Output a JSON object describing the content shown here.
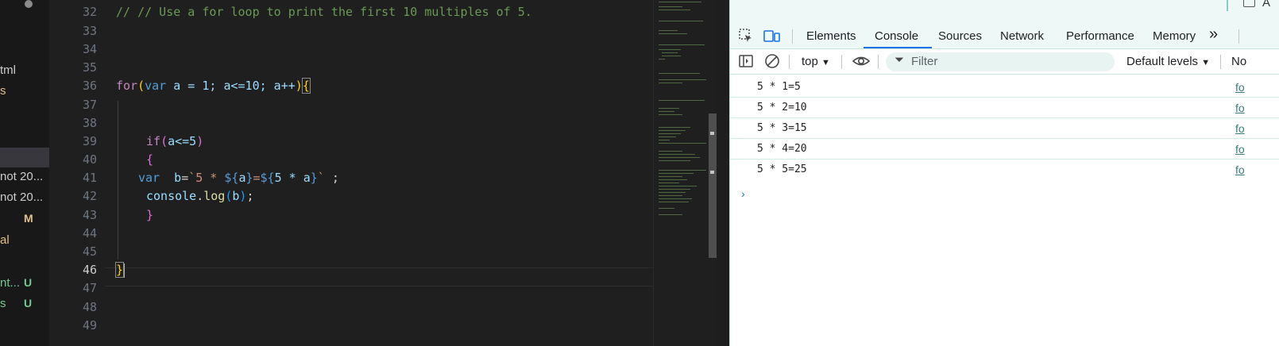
{
  "explorer": {
    "items": [
      {
        "label": "tml"
      },
      {
        "label": "s"
      },
      {
        "label": "not 20..."
      },
      {
        "label": "not 20..."
      },
      {
        "label": "al"
      },
      {
        "label": "nt..."
      },
      {
        "label": "s"
      }
    ],
    "badges": [
      "M",
      "U",
      "U"
    ]
  },
  "editor": {
    "line_numbers": [
      "32",
      "33",
      "34",
      "35",
      "36",
      "37",
      "38",
      "39",
      "40",
      "41",
      "42",
      "43",
      "44",
      "45",
      "46",
      "47",
      "48",
      "49"
    ],
    "active_line": "46",
    "lines": {
      "l32": "// // Use a for loop to print the first 10 multiples of 5.",
      "l36": {
        "kw": "for",
        "p1o": "(",
        "kb": "var",
        "rest": " a = 1; a<=10; a++",
        "p1c": ")",
        "brace": "{"
      },
      "l39": {
        "kw": "if",
        "p2o": "(",
        "rest": "a<=5",
        "p2c": ")"
      },
      "l40": "{",
      "l41": {
        "kb": "var",
        "v": "  b",
        "eq": "=",
        "tpl1": "`5 * ",
        "d1": "${",
        "a1": "a",
        "c1": "}",
        "eq2": "=",
        "d2": "${",
        "e2": "5 * a",
        "c2": "}",
        "tpl2": "`",
        "end": " ;"
      },
      "l42": {
        "obj": "console",
        "dot": ".",
        "fn": "log",
        "po": "(",
        "arg": "b",
        "pc": ")",
        "semi": ";"
      },
      "l43": "}",
      "l46": "}"
    }
  },
  "devtools": {
    "tabs": [
      "Elements",
      "Console",
      "Sources",
      "Network",
      "Performance",
      "Memory"
    ],
    "active_tab": "Console",
    "more_tabs": "»",
    "top_right_text": "A",
    "console_bar": {
      "context": "top",
      "filter_placeholder": "Filter",
      "levels": "Default levels",
      "issues": "No"
    },
    "messages": [
      {
        "text": "5 * 1=5",
        "source": "fo"
      },
      {
        "text": "5 * 2=10",
        "source": "fo"
      },
      {
        "text": "5 * 3=15",
        "source": "fo"
      },
      {
        "text": "5 * 4=20",
        "source": "fo"
      },
      {
        "text": "5 * 5=25",
        "source": "fo"
      }
    ],
    "prompt": "›"
  }
}
